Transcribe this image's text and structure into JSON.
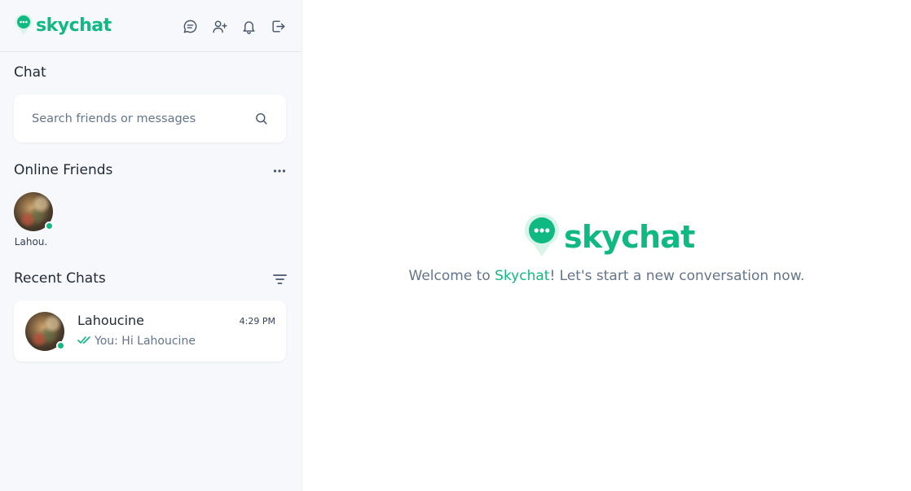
{
  "colors": {
    "accent": "#10b981",
    "sidebar_bg": "#f7f8fb",
    "text_muted": "#64748b"
  },
  "brand": {
    "name": "skychat",
    "logo_icon": "chat-bubble-pin-icon"
  },
  "header_actions": [
    {
      "icon": "chat-icon"
    },
    {
      "icon": "add-user-icon"
    },
    {
      "icon": "bell-icon"
    },
    {
      "icon": "logout-icon"
    }
  ],
  "sidebar": {
    "chat_title": "Chat",
    "search": {
      "placeholder": "Search friends or messages",
      "value": "",
      "icon": "search-icon"
    },
    "online_friends": {
      "title": "Online Friends",
      "menu_icon": "more-horizontal-icon",
      "friends": [
        {
          "name": "Lahou.",
          "status": "online"
        }
      ]
    },
    "recent_chats": {
      "title": "Recent Chats",
      "filter_icon": "filter-icon",
      "chats": [
        {
          "name": "Lahoucine",
          "time": "4:29 PM",
          "preview": "You: Hi Lahoucine",
          "read_icon": "double-check-icon",
          "status": "online"
        }
      ]
    }
  },
  "main": {
    "logo_text": "skychat",
    "welcome_prefix": "Welcome to ",
    "welcome_brand": "Skychat",
    "welcome_suffix": "! Let's start a new conversation now."
  }
}
